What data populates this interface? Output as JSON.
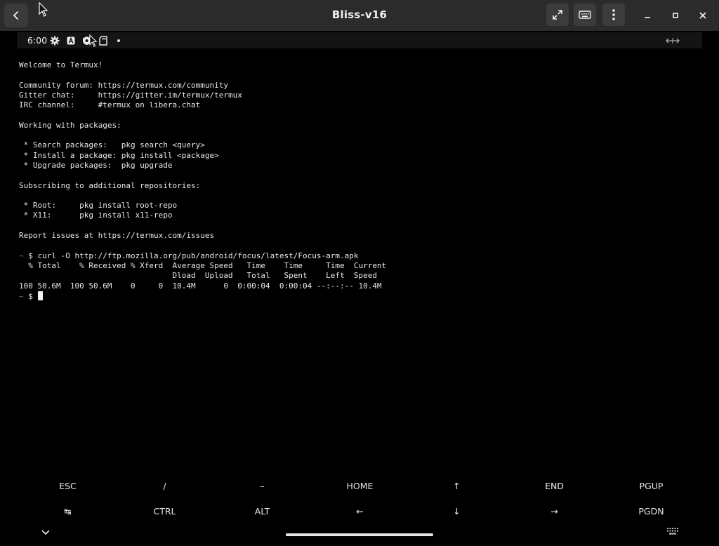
{
  "window": {
    "title": "Bliss-v16",
    "buttons": [
      "back-icon",
      "fullscreen-icon",
      "keyboard-icon",
      "menu-dots-icon",
      "minimize-icon",
      "maximize-icon",
      "close-icon"
    ]
  },
  "status_bar": {
    "time": "6:00",
    "icons": [
      "settings-gear-icon",
      "a-font-icon",
      "shield-icon",
      "sd-card-icon",
      "notification-dot-icon",
      "resize-arrows-icon"
    ]
  },
  "terminal": {
    "lines": [
      "Welcome to Termux!",
      "",
      "Community forum: https://termux.com/community",
      "Gitter chat:     https://gitter.im/termux/termux",
      "IRC channel:     #termux on libera.chat",
      "",
      "Working with packages:",
      "",
      " * Search packages:   pkg search <query>",
      " * Install a package: pkg install <package>",
      " * Upgrade packages:  pkg upgrade",
      "",
      "Subscribing to additional repositories:",
      "",
      " * Root:     pkg install root-repo",
      " * X11:      pkg install x11-repo",
      "",
      "Report issues at https://termux.com/issues",
      ""
    ],
    "command_prompt": "~",
    "command": " $ curl -O http://ftp.mozilla.org/pub/android/focus/latest/Focus-arm.apk",
    "progress_header1": "  % Total    % Received % Xferd  Average Speed   Time    Time     Time  Current",
    "progress_header2": "                                 Dload  Upload   Total   Spent    Left  Speed",
    "progress_row": "100 50.6M  100 50.6M    0     0  10.4M      0  0:00:04  0:00:04 --:--:-- 10.4M",
    "final_prompt_tilde": "~",
    "final_prompt": " $ "
  },
  "extra_keys": {
    "row1": [
      "ESC",
      "/",
      "–",
      "HOME",
      "↑",
      "END",
      "PGUP"
    ],
    "row2": [
      "↹",
      "CTRL",
      "ALT",
      "←",
      "↓",
      "→",
      "PGDN"
    ]
  },
  "nav_bar": {
    "icons": [
      "chevron-down-icon",
      "home-pill",
      "keyboard-icon"
    ]
  },
  "colors": {
    "titlebar_bg": "#2b2b2b",
    "terminal_bg": "#000000",
    "terminal_fg": "#e8e8e8"
  }
}
